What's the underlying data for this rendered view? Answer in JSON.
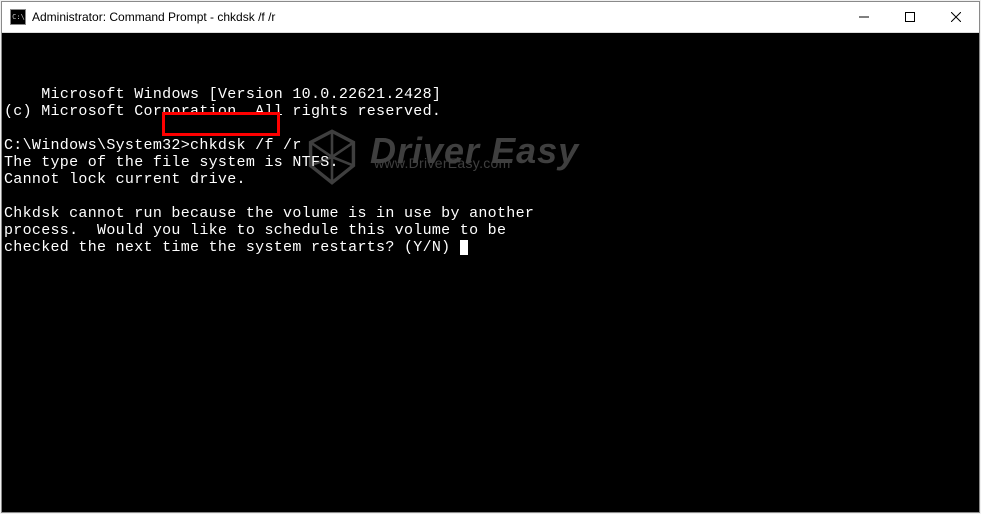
{
  "titlebar": {
    "icon_glyph": "C:\\",
    "title": "Administrator: Command Prompt - chkdsk  /f /r"
  },
  "terminal": {
    "line1": "Microsoft Windows [Version 10.0.22621.2428]",
    "line2": "(c) Microsoft Corporation. All rights reserved.",
    "blank1": "",
    "prompt_path": "C:\\Windows\\System32>",
    "command": "chkdsk /f /r",
    "line4": "The type of the file system is NTFS.",
    "line5": "Cannot lock current drive.",
    "blank2": "",
    "line6": "Chkdsk cannot run because the volume is in use by another",
    "line7": "process.  Would you like to schedule this volume to be",
    "line8": "checked the next time the system restarts? (Y/N)"
  },
  "watermark": {
    "main": "Driver Easy",
    "sub": "www.DriverEasy.com"
  }
}
